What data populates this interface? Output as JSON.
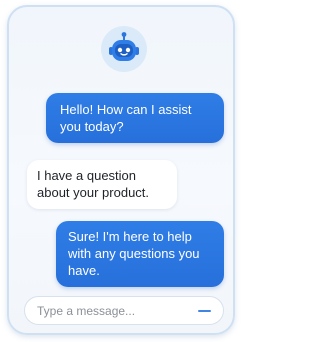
{
  "chat": {
    "avatar_icon": "robot-icon",
    "messages": [
      {
        "sender": "bot",
        "text": "Hello! How can I assist\nyou today?"
      },
      {
        "sender": "user",
        "text": "I have a question\nabout your product."
      },
      {
        "sender": "bot",
        "text": "Sure! I'm here to help\nwith any questions you\nhave."
      }
    ]
  },
  "composer": {
    "placeholder": "Type a message...",
    "send_icon": "send-icon"
  },
  "colors": {
    "bot_bubble": "#2f7de6",
    "user_bubble": "#ffffff",
    "accent": "#3f86e4",
    "avatar_bg": "#dbeaf9",
    "frame_border": "#cfe0f3"
  }
}
